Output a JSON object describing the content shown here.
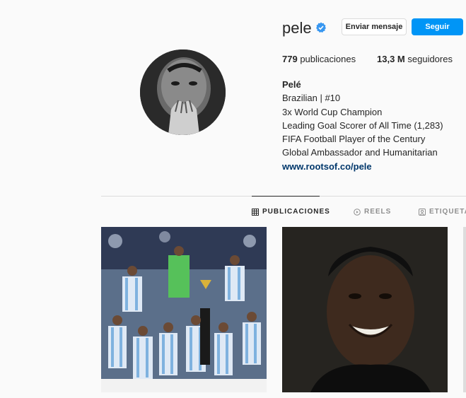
{
  "profile": {
    "username": "pele",
    "verified_icon": "verified-badge-icon",
    "message_button": "Enviar mensaje",
    "follow_button": "Seguir",
    "posts_count": "779",
    "posts_label": "publicaciones",
    "followers_count": "13,3 M",
    "followers_label": "seguidores"
  },
  "bio": {
    "name": "Pelé",
    "lines": [
      "Brazilian | #10",
      "3x World Cup Champion",
      "Leading Goal Scorer of All Time (1,283)",
      "FIFA Football Player of the Century",
      "Global Ambassador and Humanitarian"
    ],
    "link": "www.rootsof.co/pele"
  },
  "tabs": [
    {
      "label": "PUBLICACIONES",
      "icon": "grid-icon",
      "active": true
    },
    {
      "label": "REELS",
      "icon": "reels-icon",
      "active": false
    },
    {
      "label": "ETIQUETAD",
      "icon": "tagged-icon",
      "active": false
    }
  ],
  "colors": {
    "accent": "#0095f6",
    "link": "#00376b",
    "verified": "#3897f0",
    "background": "#fafafa"
  }
}
